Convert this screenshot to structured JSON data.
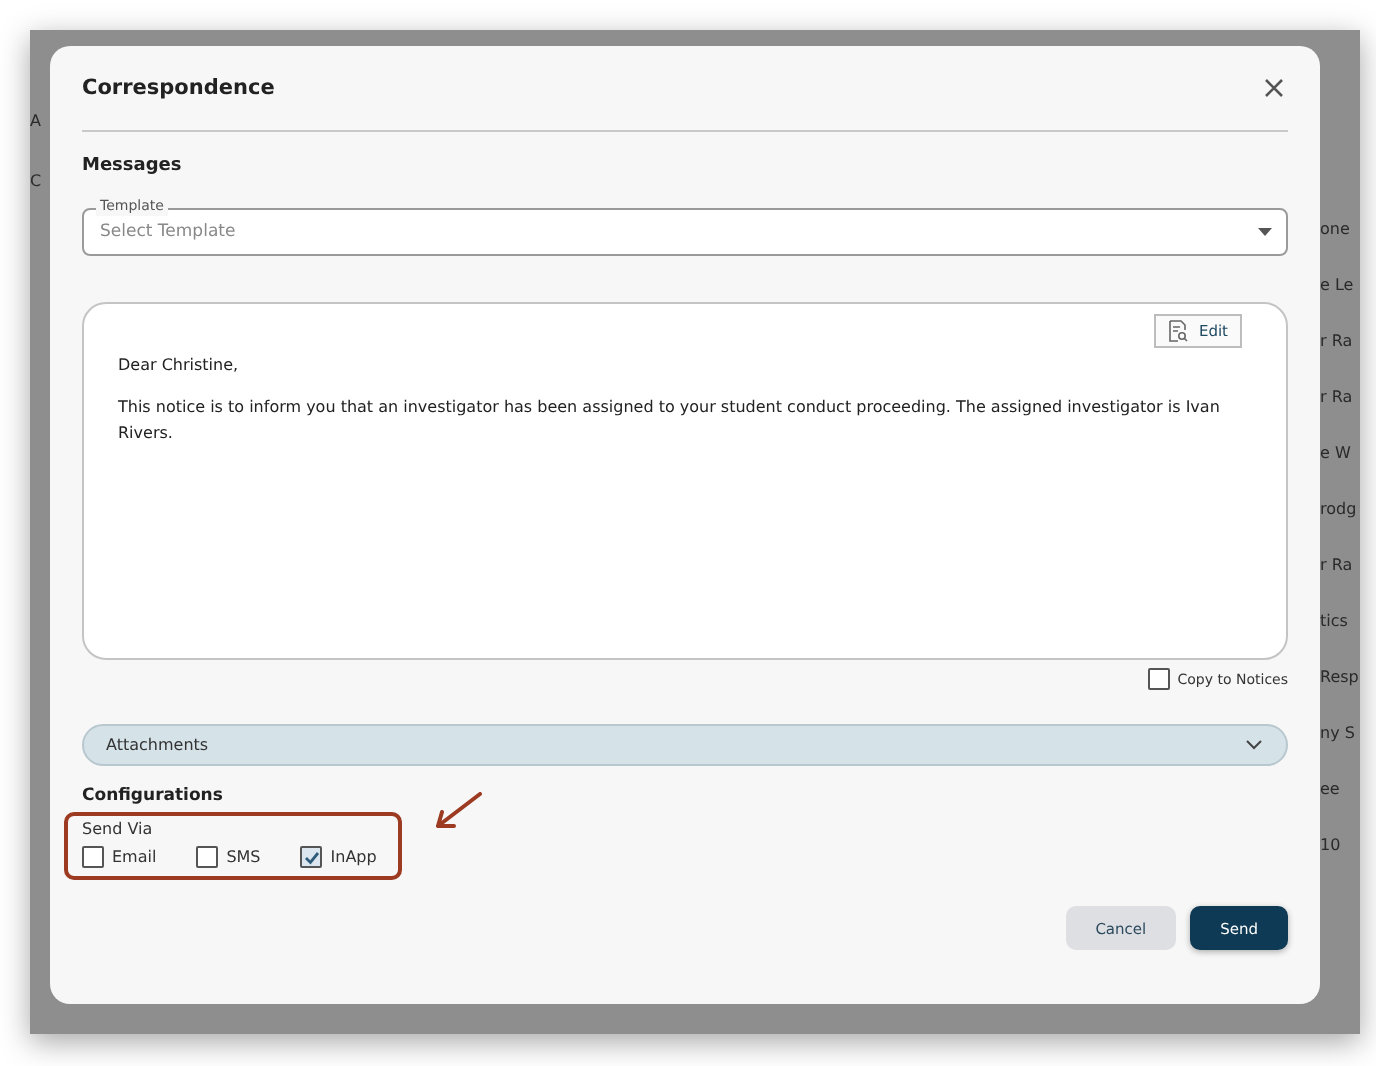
{
  "background": {
    "left_fragments": [
      "A",
      "C"
    ],
    "right_fragments": [
      "one",
      "e Le",
      "r Ra",
      "r Ra",
      "e W",
      "rodg",
      "r Ra",
      "tics",
      "Resp",
      "ny S",
      "ee",
      "10"
    ]
  },
  "dialog": {
    "title": "Correspondence",
    "section": "Messages",
    "template": {
      "label": "Template",
      "placeholder": "Select Template"
    },
    "message": {
      "edit_button": "Edit",
      "paragraphs": [
        "Dear Christine,",
        "This notice is to inform you that an investigator has been assigned to your student conduct proceeding. The assigned investigator is Ivan Rivers."
      ]
    },
    "copy_to_notices": {
      "label": "Copy to Notices",
      "checked": false
    },
    "attachments": {
      "label": "Attachments",
      "expanded": false
    },
    "configurations": {
      "title": "Configurations",
      "send_via": {
        "label": "Send Via",
        "options": [
          {
            "label": "Email",
            "checked": false
          },
          {
            "label": "SMS",
            "checked": false
          },
          {
            "label": "InApp",
            "checked": true
          }
        ]
      }
    },
    "buttons": [
      {
        "label": "Cancel",
        "kind": "secondary"
      },
      {
        "label": "Send",
        "kind": "primary"
      }
    ]
  }
}
